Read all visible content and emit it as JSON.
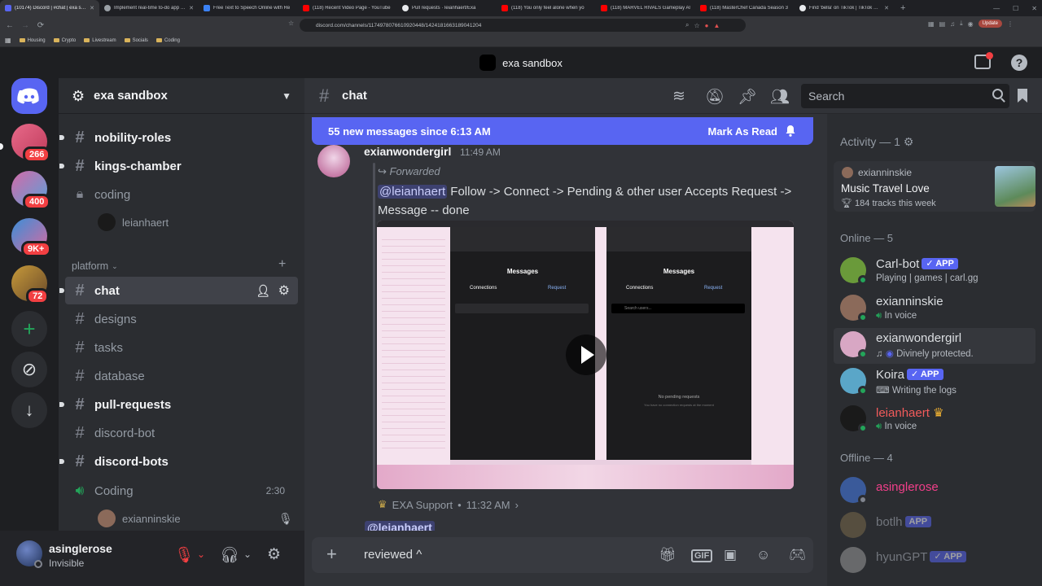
{
  "browser": {
    "tabs": [
      {
        "title": "(10174) Discord | #chat | exa san",
        "color": "#5865f2",
        "active": true
      },
      {
        "title": "Implement real-time to-do app with",
        "color": "#9aa0a6"
      },
      {
        "title": "Free Text to Speech Online with Re",
        "color": "#3b82f6"
      },
      {
        "title": "(118) Recent Video Page - YouTube",
        "color": "#ff0000"
      },
      {
        "title": "Pull requests · leianhaert/Exa",
        "color": "#e8eaed"
      },
      {
        "title": "(118) You only feel alone when yo",
        "color": "#ff0000"
      },
      {
        "title": "(118) MARVEL RIVALS Gameplay Al",
        "color": "#ff0000"
      },
      {
        "title": "(118) MasterChef Canada Season 3",
        "color": "#ff0000"
      },
      {
        "title": "Find 'bella' on TikTok | TikTok Search",
        "color": "#e8eaed"
      }
    ],
    "new_tab": "+",
    "url": "discord.com/channels/1174978076610920448/1424181663189041204",
    "update_label": "Update",
    "bookmarks": [
      "Housing",
      "Crypto",
      "Livestream",
      "Socials",
      "Coding"
    ]
  },
  "app_title": "exa sandbox",
  "rail": {
    "servers": [
      {
        "badge": "266"
      },
      {
        "badge": "400"
      },
      {
        "badge": "9K+"
      },
      {
        "badge": "72"
      }
    ],
    "add_label": "+",
    "download_label": "↓"
  },
  "sidebar": {
    "server_name": "exa sandbox",
    "channels_top": [
      {
        "name": "nobility-roles"
      },
      {
        "name": "kings-chamber"
      },
      {
        "name": "coding"
      }
    ],
    "coding_voice_user": "leianhaert",
    "category": "platform",
    "channels": [
      {
        "name": "chat"
      },
      {
        "name": "designs"
      },
      {
        "name": "tasks"
      },
      {
        "name": "database"
      },
      {
        "name": "pull-requests"
      },
      {
        "name": "discord-bot"
      },
      {
        "name": "discord-bots"
      }
    ],
    "voice_channel": "Coding",
    "voice_timer": "2:30",
    "voice_user": "exianninskie"
  },
  "user_panel": {
    "name": "asinglerose",
    "status": "Invisible"
  },
  "header": {
    "channel": "chat",
    "search_placeholder": "Search"
  },
  "chat": {
    "new_messages": "55 new messages since 6:13 AM",
    "mark_as_read": "Mark As Read",
    "message": {
      "author": "exianwondergirl",
      "time": "11:49 AM",
      "forwarded": "Forwarded",
      "mention": "@leianhaert",
      "text": "Follow -> Connect -> Pending & other user Accepts Request -> Message -- done"
    },
    "video": {
      "left_panel_title": "Messages",
      "left_tab_1": "Connections",
      "left_tab_2": "Request",
      "right_panel_title": "Messages",
      "right_tab_1": "Connections",
      "right_tab_2": "Request",
      "search_hint": "Search users...",
      "no_pending": "No pending requests",
      "no_pending_sub": "You have no connection requests at the moment"
    },
    "next_meta_author": "EXA Support",
    "next_meta_time": "11:32 AM",
    "next_mention": "@leianhaert"
  },
  "composer": {
    "value": "reviewed ^",
    "gif_label": "GIF"
  },
  "members": {
    "activity_header": "Activity — 1",
    "activity": {
      "user": "exianninskie",
      "title": "Music Travel Love",
      "detail": "184 tracks this week"
    },
    "online_header": "Online — 5",
    "online": [
      {
        "name": "Carl-bot",
        "app": "APP",
        "verified": true,
        "sub": "Playing | games | carl.gg",
        "color": "#dbdee1",
        "av": "#6a9a3a"
      },
      {
        "name": "exianninskie",
        "sub": "In voice",
        "color": "#dbdee1",
        "av": "#8b6a5a"
      },
      {
        "name": "exianwondergirl",
        "sub": "Divinely protected.",
        "color": "#dbdee1",
        "av": "#d8a7c4"
      },
      {
        "name": "Koira",
        "app": "APP",
        "verified": true,
        "sub": "Writing the logs",
        "color": "#dbdee1",
        "av": "#5aa6c8"
      },
      {
        "name": "leianhaert",
        "sub": "In voice",
        "color": "#f25b5b",
        "av": "#1a1a1a"
      }
    ],
    "offline_header": "Offline — 4",
    "offline": [
      {
        "name": "asinglerose",
        "color": "#f23f8a",
        "av": "#3a5a9a"
      },
      {
        "name": "botlh",
        "app": "APP",
        "color": "#72767d",
        "av": "#7a6a4a"
      },
      {
        "name": "hyunGPT",
        "app": "APP",
        "verified": true,
        "color": "#72767d",
        "av": "#9a9a9a"
      }
    ]
  }
}
